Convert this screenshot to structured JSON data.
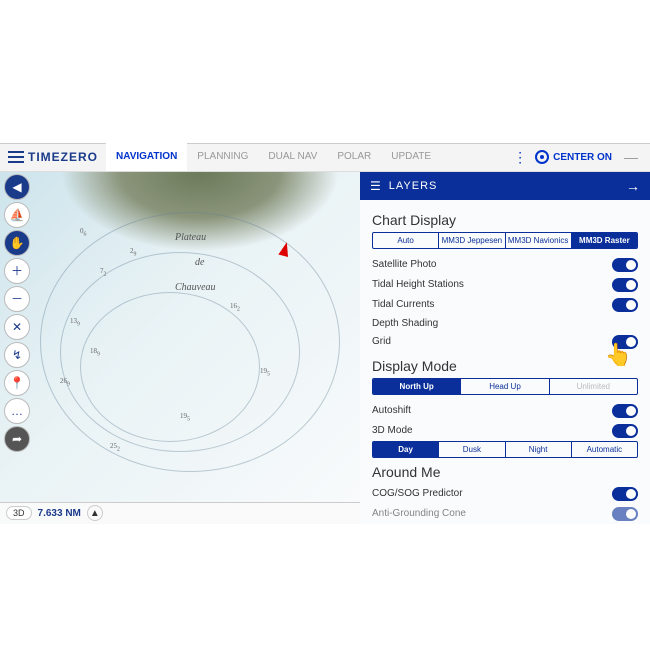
{
  "brand": "TIMEZERO",
  "tabs": [
    "NAVIGATION",
    "PLANNING",
    "DUAL NAV",
    "POLAR",
    "UPDATE"
  ],
  "active_tab": 0,
  "center_on": "CENTER ON",
  "chart": {
    "place1": "Plateau",
    "place2": "de",
    "place3": "Chauveau",
    "scale_3d": "3D",
    "distance": "7.633 NM"
  },
  "layers": {
    "title": "LAYERS",
    "sections": {
      "chart_display": {
        "title": "Chart Display",
        "seg": [
          "Auto",
          "MM3D Jeppesen",
          "MM3D Navionics",
          "MM3D Raster"
        ],
        "seg_active": 3,
        "items": [
          {
            "label": "Satellite Photo",
            "on": true
          },
          {
            "label": "Tidal Height Stations",
            "on": true
          },
          {
            "label": "Tidal Currents",
            "on": true
          },
          {
            "label": "Depth Shading",
            "on": false,
            "hide_toggle": true
          },
          {
            "label": "Grid",
            "on": true
          }
        ]
      },
      "display_mode": {
        "title": "Display Mode",
        "seg1": [
          "North Up",
          "Head Up",
          "Unlimited"
        ],
        "seg1_active": 0,
        "items": [
          {
            "label": "Autoshift",
            "on": true
          },
          {
            "label": "3D Mode",
            "on": true
          }
        ],
        "seg2": [
          "Day",
          "Dusk",
          "Night",
          "Automatic"
        ],
        "seg2_active": 0
      },
      "around_me": {
        "title": "Around Me",
        "items": [
          {
            "label": "COG/SOG Predictor",
            "on": true
          },
          {
            "label": "Anti-Grounding Cone",
            "on": true
          }
        ]
      }
    }
  }
}
